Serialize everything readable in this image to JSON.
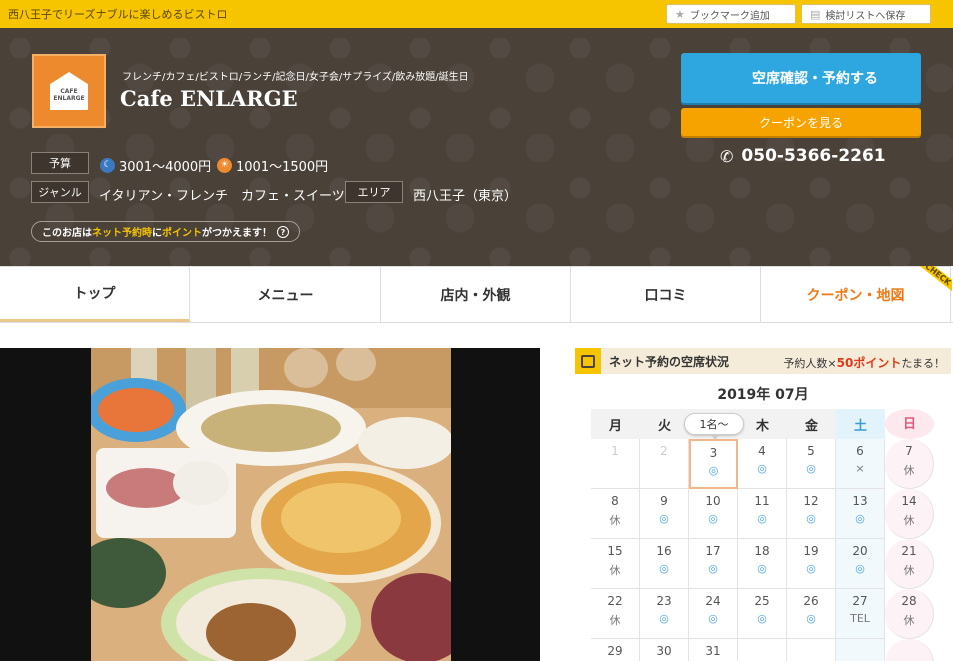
{
  "topbar": {
    "tagline": "西八王子でリーズナブルに楽しめるビストロ",
    "bookmark_label": "ブックマーク追加",
    "list_label": "検討リストへ保存"
  },
  "shop": {
    "logo_text": "CAFE ENLARGE",
    "genres": "フレンチ/カフェ/ビストロ/ランチ/記念日/女子会/サプライズ/飲み放題/誕生日",
    "name": "Cafe ENLARGE",
    "budget_label": "予算",
    "budget_dinner": "3001～4000円",
    "budget_lunch": "1001～1500円",
    "genre_label": "ジャンル",
    "genre_value": "イタリアン・フレンチ　カフェ・スイーツ",
    "area_label": "エリア",
    "area_value": "西八王子（東京）",
    "points_pre": "このお店は",
    "points_hl1": "ネット予約時",
    "points_mid": "に",
    "points_hl2": "ポイント",
    "points_post": "がつかえます！",
    "points_q": "?"
  },
  "actions": {
    "reserve_label": "空席確認・予約する",
    "coupon_label": "クーポンを見る",
    "phone": "050-5366-2261"
  },
  "nav": {
    "tabs": [
      "トップ",
      "メニュー",
      "店内・外観",
      "口コミ",
      "クーポン・地図"
    ],
    "check_badge": "CHECK"
  },
  "calendar": {
    "header_title": "ネット予約の空席状況",
    "header_right_pre": "予約人数×",
    "header_right_points": "50ポイント",
    "header_right_post": "たまる！",
    "year_month": "2019年 07月",
    "party_popup": "1名～",
    "weekdays": [
      "月",
      "火",
      "水",
      "木",
      "金",
      "土",
      "日"
    ],
    "rows": [
      [
        [
          "1",
          ""
        ],
        [
          "2",
          ""
        ],
        [
          "3",
          "◎"
        ],
        [
          "4",
          "◎"
        ],
        [
          "5",
          "◎"
        ],
        [
          "6",
          "×"
        ],
        [
          "7",
          "休"
        ]
      ],
      [
        [
          "8",
          "休"
        ],
        [
          "9",
          "◎"
        ],
        [
          "10",
          "◎"
        ],
        [
          "11",
          "◎"
        ],
        [
          "12",
          "◎"
        ],
        [
          "13",
          "◎"
        ],
        [
          "14",
          "休"
        ]
      ],
      [
        [
          "15",
          "休"
        ],
        [
          "16",
          "◎"
        ],
        [
          "17",
          "◎"
        ],
        [
          "18",
          "◎"
        ],
        [
          "19",
          "◎"
        ],
        [
          "20",
          "◎"
        ],
        [
          "21",
          "休"
        ]
      ],
      [
        [
          "22",
          "休"
        ],
        [
          "23",
          "◎"
        ],
        [
          "24",
          "◎"
        ],
        [
          "25",
          "◎"
        ],
        [
          "26",
          "◎"
        ],
        [
          "27",
          "TEL"
        ],
        [
          "28",
          "休"
        ]
      ],
      [
        [
          "29",
          ""
        ],
        [
          "30",
          ""
        ],
        [
          "31",
          ""
        ],
        [
          "",
          ""
        ],
        [
          "",
          ""
        ],
        [
          "",
          ""
        ],
        [
          "",
          ""
        ]
      ]
    ]
  }
}
